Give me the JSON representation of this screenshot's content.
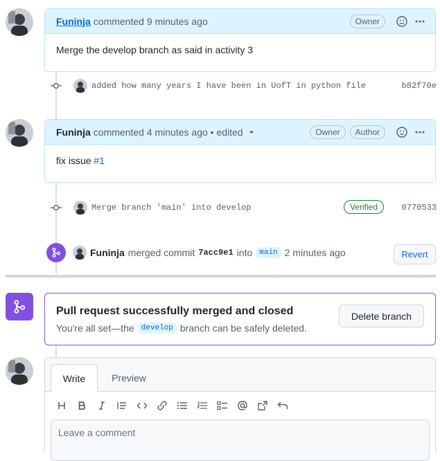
{
  "comments": [
    {
      "author": "Funinja",
      "meta": "commented 9 minutes ago",
      "badges": [
        "Owner"
      ],
      "body": "Merge the develop branch as said in activity 3"
    },
    {
      "author": "Funinja",
      "meta": "commented 4 minutes ago • edited",
      "badges": [
        "Owner",
        "Author"
      ],
      "body_prefix": "fix issue ",
      "body_link": "#1"
    }
  ],
  "commits": [
    {
      "message": "added how many years I have been in UofT in python file",
      "sha": "b82f70e"
    },
    {
      "message": "Merge branch 'main' into develop",
      "sha": "0770533",
      "verified": "Verified"
    }
  ],
  "merge_event": {
    "author": "Funinja",
    "action": "merged commit",
    "commit": "7acc9e1",
    "into": "into",
    "branch": "main",
    "time": "2 minutes ago",
    "revert_label": "Revert"
  },
  "merged_status": {
    "title": "Pull request successfully merged and closed",
    "text_prefix": "You're all set—the",
    "branch": "develop",
    "text_suffix": "branch can be safely deleted.",
    "delete_label": "Delete branch"
  },
  "editor": {
    "tabs": [
      "Write",
      "Preview"
    ],
    "placeholder": "Leave a comment",
    "toolbar_icons": [
      "heading-icon",
      "bold-icon",
      "italic-icon",
      "quote-icon",
      "code-icon",
      "link-icon",
      "unordered-list-icon",
      "ordered-list-icon",
      "task-list-icon",
      "mention-icon",
      "reference-icon",
      "undo-icon"
    ]
  },
  "colors": {
    "accent": "#0969da",
    "merged": "#8250df",
    "comment_header": "#ddf4ff",
    "verified": "#1a7f37"
  }
}
